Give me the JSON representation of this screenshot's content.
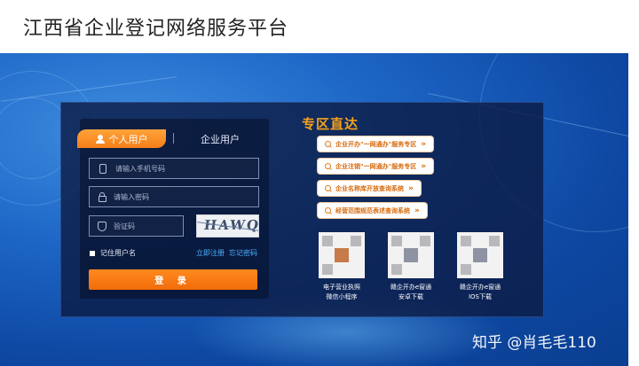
{
  "header": {
    "title": "江西省企业登记网络服务平台"
  },
  "login": {
    "tabs": [
      {
        "label": "个人用户",
        "active": true
      },
      {
        "label": "企业用户",
        "active": false
      }
    ],
    "phone": {
      "placeholder": "请输入手机号码",
      "value": ""
    },
    "password": {
      "placeholder": "请输入密码",
      "value": ""
    },
    "captcha": {
      "placeholder": "验证码",
      "value": "",
      "image_text": "HAWQ"
    },
    "remember_label": "记住用户名",
    "register_link": "立即注册",
    "forgot_link": "忘记密码",
    "submit_label": "登 录"
  },
  "zone": {
    "title": "专区直达",
    "links": [
      {
        "label": "企业开办\"一网通办\"服务专区"
      },
      {
        "label": "企业注销\"一网通办\"服务专区"
      },
      {
        "label": "企业名称库开放查询系统"
      },
      {
        "label": "经营范围规范表述查询系统"
      }
    ],
    "qrcodes": [
      {
        "line1": "电子营业执照",
        "line2": "微信小程序"
      },
      {
        "line1": "赣企开办e窗通",
        "line2": "安卓下载"
      },
      {
        "line1": "赣企开办e窗通",
        "line2": "IOS下载"
      }
    ]
  },
  "watermark": "知乎 @肖毛毛110",
  "colors": {
    "accent_orange": "#f57f18",
    "zone_title": "#f7a21b",
    "link_blue": "#4fb3ff",
    "panel": "#0c1c46"
  }
}
